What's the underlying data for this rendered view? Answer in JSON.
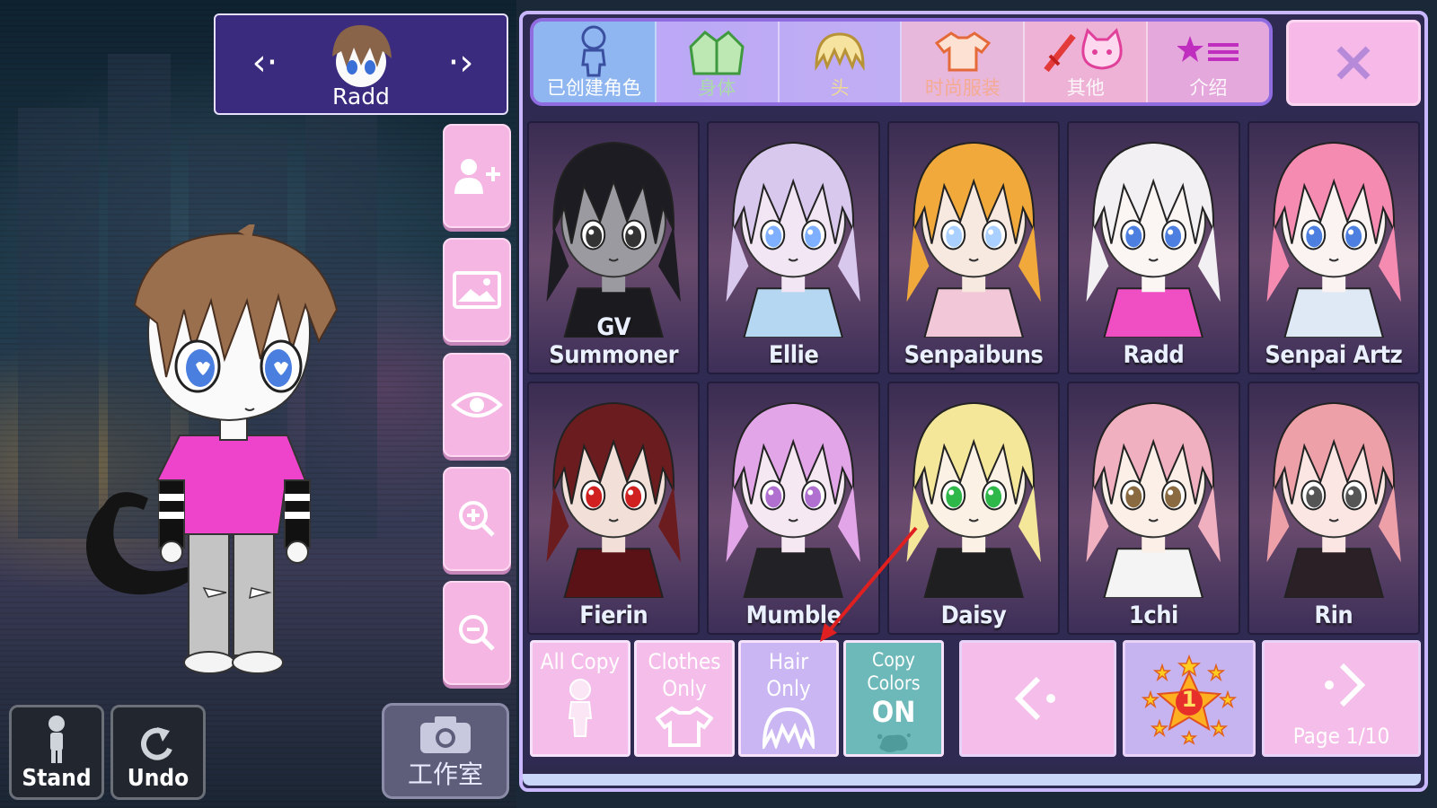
{
  "selector": {
    "name": "Radd"
  },
  "tabs": [
    {
      "label": "已创建角色",
      "icon": "character-silhouette-icon",
      "active": true
    },
    {
      "label": "身体",
      "icon": "jacket-icon",
      "active": false
    },
    {
      "label": "头",
      "icon": "hair-icon",
      "active": false
    },
    {
      "label": "时尚服装",
      "icon": "tshirt-icon",
      "active": false
    },
    {
      "label": "其他",
      "icon": "sword-cat-icon",
      "active": false
    },
    {
      "label": "介绍",
      "icon": "star-list-icon",
      "active": false
    }
  ],
  "characters": [
    {
      "name": "GV Summoner",
      "hair": "#1c1c22",
      "skin": "#9a9aa0",
      "outfit": "#1a1a1f",
      "eye": "#333"
    },
    {
      "name": "Ellie",
      "hair": "#d9c8ee",
      "skin": "#f2e6f4",
      "outfit": "#b6d7f2",
      "eye": "#7fb0ff"
    },
    {
      "name": "Senpaibuns",
      "hair": "#f0a93a",
      "skin": "#f7e9df",
      "outfit": "#f2c8d8",
      "eye": "#a9d0ff"
    },
    {
      "name": "Radd",
      "hair": "#f2f0f2",
      "skin": "#fbf6f4",
      "outfit": "#f04fc4",
      "eye": "#4c7fe0"
    },
    {
      "name": "Senpai Artz",
      "hair": "#f58bb0",
      "skin": "#fbf2f2",
      "outfit": "#dfe9f6",
      "eye": "#4c7fe0"
    },
    {
      "name": "Fierin",
      "hair": "#6b1c1f",
      "skin": "#f1dfd8",
      "outfit": "#5a1216",
      "eye": "#d02020"
    },
    {
      "name": "Mumble",
      "hair": "#e2a5e8",
      "skin": "#f6e8f2",
      "outfit": "#222226",
      "eye": "#b070d0"
    },
    {
      "name": "Daisy",
      "hair": "#f5e79a",
      "skin": "#fbf1e4",
      "outfit": "#1f1f22",
      "eye": "#2fb84a"
    },
    {
      "name": "1chi",
      "hair": "#f0b0c0",
      "skin": "#fbefe8",
      "outfit": "#f4f4f4",
      "eye": "#8a6a40"
    },
    {
      "name": "Rin",
      "hair": "#eea0a8",
      "skin": "#fbe6e4",
      "outfit": "#2a2025",
      "eye": "#555"
    }
  ],
  "copy_options": [
    {
      "label": "All Copy",
      "icon": "body-silhouette-icon"
    },
    {
      "label": "Clothes\nOnly",
      "icon": "tshirt-icon"
    },
    {
      "label": "Hair\nOnly",
      "icon": "hair-icon"
    },
    {
      "label": "Copy Colors",
      "state": "ON",
      "icon": "paint-splash-icon"
    }
  ],
  "pagination": {
    "page_label": "Page 1/10",
    "badge_number": "1"
  },
  "left_buttons": {
    "stand": "Stand",
    "undo": "Undo",
    "studio": "工作室"
  },
  "colors": {
    "panel": "#2e2a52",
    "accent_purple": "#8f6ce0",
    "button_pink": "#f6b6e3",
    "copy_colors_teal": "#6db8b8",
    "annotation_arrow": "#e02020"
  }
}
